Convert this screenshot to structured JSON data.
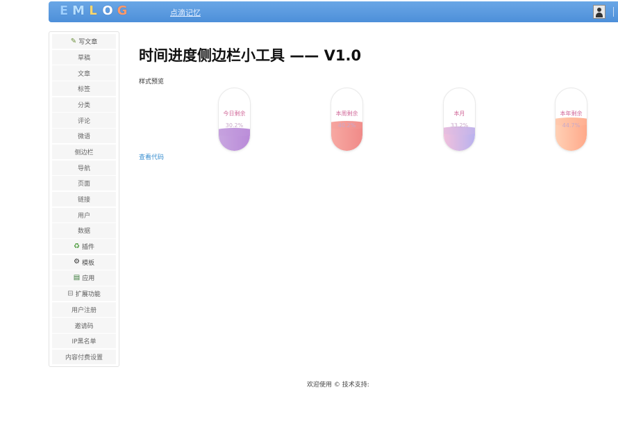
{
  "header": {
    "logo_letters": [
      "E",
      "M",
      "L",
      "O",
      "G"
    ],
    "site_name": "点滴记忆",
    "user_icon": "user-icon"
  },
  "sidebar": {
    "items": [
      {
        "label": "写文章",
        "icon": "write-icon"
      },
      {
        "label": "草稿"
      },
      {
        "label": "文章"
      },
      {
        "label": "标签"
      },
      {
        "label": "分类"
      },
      {
        "label": "评论"
      },
      {
        "label": "微语"
      },
      {
        "label": "侧边栏"
      },
      {
        "label": "导航"
      },
      {
        "label": "页面"
      },
      {
        "label": "链接"
      },
      {
        "label": "用户"
      },
      {
        "label": "数据"
      },
      {
        "label": "插件",
        "icon": "plugin-icon"
      },
      {
        "label": "模板",
        "icon": "gear-icon"
      },
      {
        "label": "应用",
        "icon": "app-icon"
      },
      {
        "label": "扩展功能",
        "icon": "expand-icon"
      },
      {
        "label": "用户注册"
      },
      {
        "label": "邀请码"
      },
      {
        "label": "IP黑名单"
      },
      {
        "label": "内容付费设置"
      }
    ]
  },
  "main": {
    "title": "时间进度侧边栏小工具 —— V1.0",
    "preview_label": "样式预览",
    "cards": [
      {
        "label": "今日剩余",
        "value": "30.2%"
      },
      {
        "label": "本周剩余",
        "value": "40.2%"
      },
      {
        "label": "本月",
        "value": "33.2%"
      },
      {
        "label": "本年剩余",
        "value": "44.7%"
      }
    ],
    "view_code_link": "查看代码"
  },
  "footer": {
    "text": "欢迎使用 © 技术支持:"
  }
}
